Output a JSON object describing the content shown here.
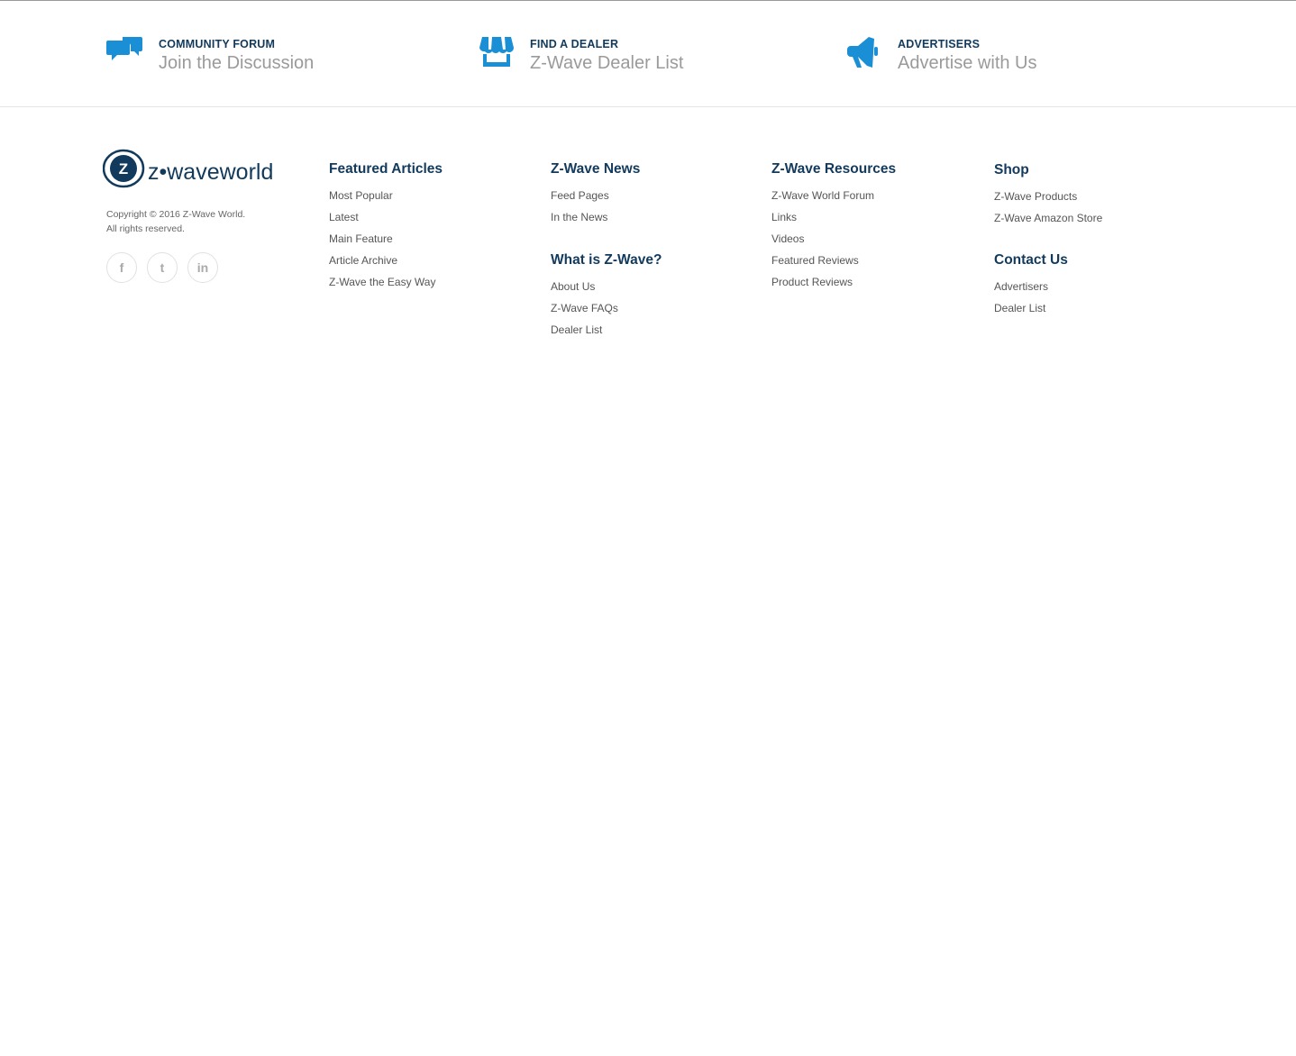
{
  "cta": [
    {
      "kicker": "COMMUNITY FORUM",
      "headline": "Join the Discussion",
      "icon": "chat-bubbles-icon"
    },
    {
      "kicker": "FIND A DEALER",
      "headline": "Z-Wave Dealer List",
      "icon": "storefront-icon"
    },
    {
      "kicker": "ADVERTISERS",
      "headline": "Advertise with Us",
      "icon": "megaphone-icon"
    }
  ],
  "brand": {
    "logo_text": "z•waveworld",
    "copyright": "Copyright © 2016 Z-Wave World.",
    "rights": "All rights reserved."
  },
  "social": [
    "f",
    "t",
    "in"
  ],
  "columns": {
    "featured": {
      "title": "Featured Articles",
      "items": [
        "Most Popular",
        "Latest",
        "Main Feature",
        "Article Archive",
        "Z-Wave the Easy Way"
      ]
    },
    "news": {
      "title": "Z-Wave News",
      "items": [
        "Feed Pages",
        "In the News"
      ]
    },
    "what": {
      "title": "What is Z-Wave?",
      "items": [
        "About Us",
        "Z-Wave FAQs",
        "Dealer List"
      ]
    },
    "resources": {
      "title": "Z-Wave Resources",
      "items": [
        "Z-Wave World Forum",
        "Links",
        "Videos",
        "Featured Reviews",
        "Product Reviews"
      ]
    },
    "shop": {
      "title": "Shop",
      "items": [
        "Z-Wave Products",
        "Z-Wave Amazon Store"
      ]
    },
    "contact": {
      "title": "Contact Us",
      "items": [
        "Advertisers",
        "Dealer List"
      ]
    }
  },
  "colors": {
    "accent": "#1a8fd6",
    "heading": "#123a5c"
  }
}
